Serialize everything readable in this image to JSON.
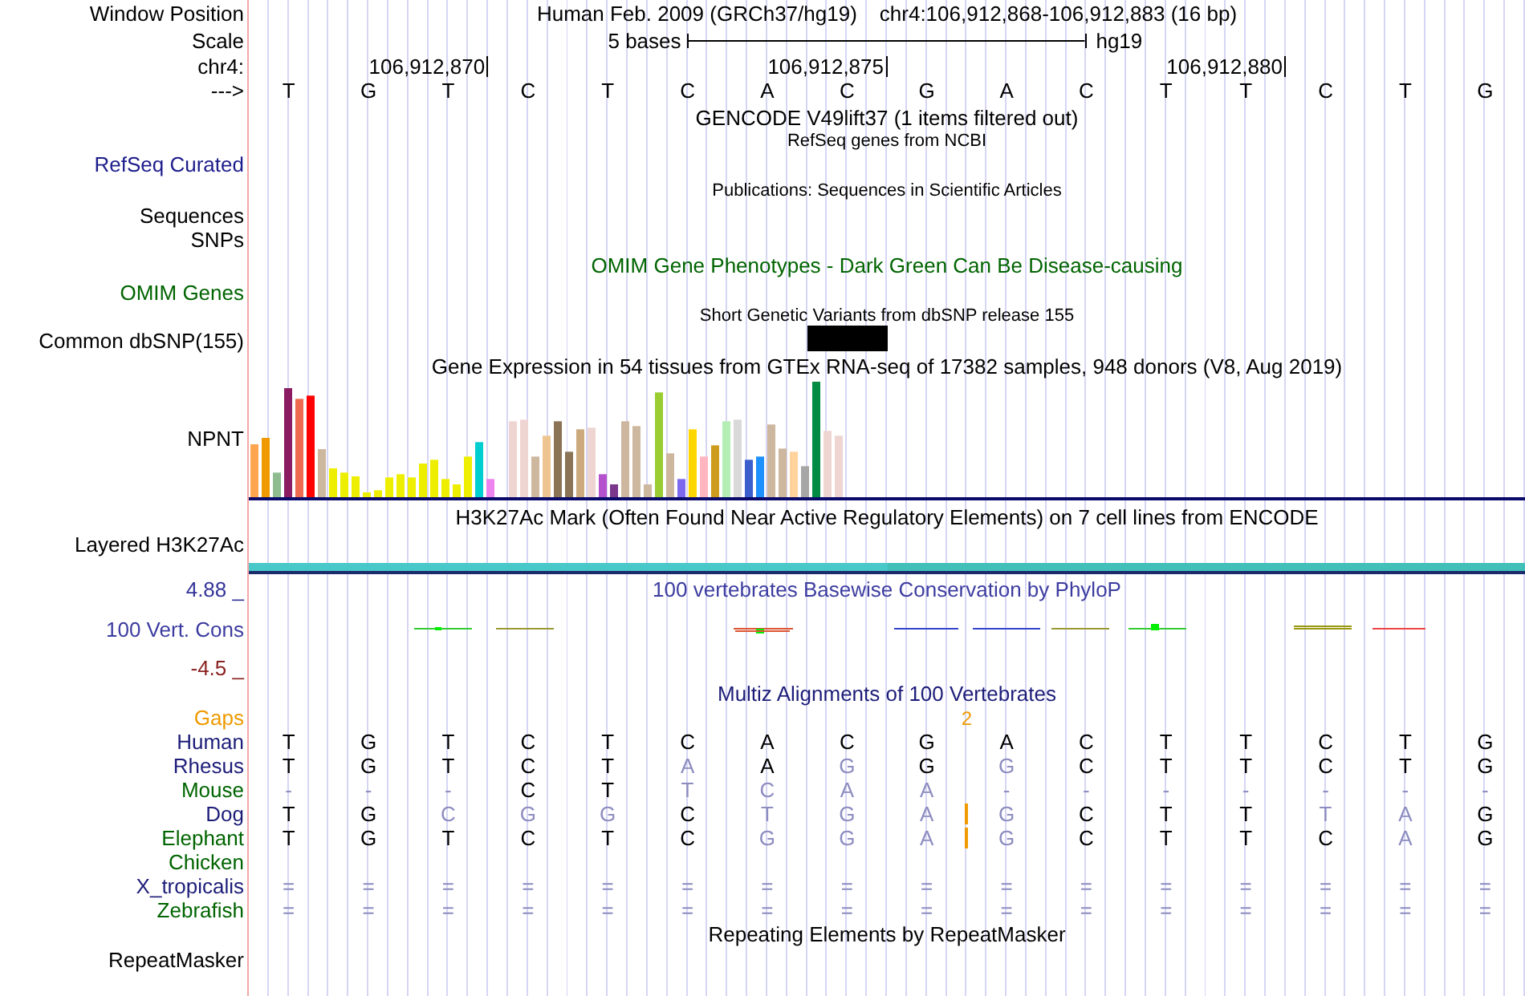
{
  "header": {
    "window_position_label": "Window Position",
    "assembly": "Human Feb. 2009 (GRCh37/hg19)",
    "region": "chr4:106,912,868-106,912,883 (16 bp)",
    "scale_label": "Scale",
    "scale_text": "5 bases",
    "scale_assembly": "hg19",
    "chrom_label": "chr4:",
    "ticks": [
      "106,912,870",
      "106,912,875",
      "106,912,880"
    ],
    "strand_label": "--->",
    "bases": [
      "T",
      "G",
      "T",
      "C",
      "T",
      "C",
      "A",
      "C",
      "G",
      "A",
      "C",
      "T",
      "T",
      "C",
      "T",
      "G"
    ]
  },
  "gencode": {
    "title": "GENCODE V49lift37 (1 items filtered out)"
  },
  "refseq": {
    "title": "RefSeq genes from NCBI",
    "label": "RefSeq Curated"
  },
  "publications": {
    "title": "Publications: Sequences in Scientific Articles",
    "labels": [
      "Sequences",
      "SNPs"
    ]
  },
  "omim": {
    "title": "OMIM Gene Phenotypes - Dark Green Can Be Disease-causing",
    "label": "OMIM Genes"
  },
  "dbsnp": {
    "title": "Short Genetic Variants from dbSNP release 155",
    "label": "Common dbSNP(155)"
  },
  "gtex": {
    "title": "Gene Expression in 54 tissues from GTEx RNA-seq of 17382 samples, 948 donors (V8, Aug 2019)",
    "label": "NPNT"
  },
  "h3k27ac": {
    "title": "H3K27Ac Mark (Often Found Near Active Regulatory Elements) on 7 cell lines from ENCODE",
    "label": "Layered H3K27Ac"
  },
  "phylop": {
    "title": "100 vertebrates Basewise Conservation by PhyloP",
    "label": "100 Vert. Cons",
    "max_label": "4.88 _",
    "min_label": "-4.5 _"
  },
  "multiz": {
    "title": "Multiz Alignments of 100 Vertebrates",
    "gaps_label": "Gaps",
    "species": [
      {
        "name": "Human",
        "color": "#1c1c78",
        "bases": [
          {
            "base": "T",
            "conserved": true
          },
          {
            "base": "G",
            "conserved": true
          },
          {
            "base": "T",
            "conserved": true
          },
          {
            "base": "C",
            "conserved": true
          },
          {
            "base": "T",
            "conserved": true
          },
          {
            "base": "C",
            "conserved": true
          },
          {
            "base": "A",
            "conserved": true
          },
          {
            "base": "C",
            "conserved": true
          },
          {
            "base": "G",
            "conserved": true,
            "gap_count": "2"
          },
          {
            "base": "A",
            "conserved": true
          },
          {
            "base": "C",
            "conserved": true
          },
          {
            "base": "T",
            "conserved": true
          },
          {
            "base": "T",
            "conserved": true
          },
          {
            "base": "C",
            "conserved": true
          },
          {
            "base": "T",
            "conserved": true
          },
          {
            "base": "G",
            "conserved": true
          }
        ]
      },
      {
        "name": "Rhesus",
        "color": "#1c1c78",
        "bases": [
          {
            "base": "T",
            "conserved": true
          },
          {
            "base": "G",
            "conserved": true
          },
          {
            "base": "T",
            "conserved": true
          },
          {
            "base": "C",
            "conserved": true
          },
          {
            "base": "T",
            "conserved": true
          },
          {
            "base": "A",
            "conserved": false
          },
          {
            "base": "A",
            "conserved": true
          },
          {
            "base": "G",
            "conserved": false
          },
          {
            "base": "G",
            "conserved": true
          },
          {
            "base": "G",
            "conserved": false
          },
          {
            "base": "C",
            "conserved": true
          },
          {
            "base": "T",
            "conserved": true
          },
          {
            "base": "T",
            "conserved": true
          },
          {
            "base": "C",
            "conserved": true
          },
          {
            "base": "T",
            "conserved": true
          },
          {
            "base": "G",
            "conserved": true
          }
        ]
      },
      {
        "name": "Mouse",
        "color": "#006400",
        "bases": [
          {
            "base": "-",
            "conserved": false
          },
          {
            "base": "-",
            "conserved": false
          },
          {
            "base": "-",
            "conserved": false
          },
          {
            "base": "C",
            "conserved": true
          },
          {
            "base": "T",
            "conserved": true
          },
          {
            "base": "T",
            "conserved": false
          },
          {
            "base": "C",
            "conserved": false
          },
          {
            "base": "A",
            "conserved": false
          },
          {
            "base": "A",
            "conserved": false
          },
          {
            "base": "-",
            "conserved": false
          },
          {
            "base": "-",
            "conserved": false
          },
          {
            "base": "-",
            "conserved": false
          },
          {
            "base": "-",
            "conserved": false
          },
          {
            "base": "-",
            "conserved": false
          },
          {
            "base": "-",
            "conserved": false
          },
          {
            "base": "-",
            "conserved": false
          }
        ]
      },
      {
        "name": "Dog",
        "color": "#1c1c78",
        "bases": [
          {
            "base": "T",
            "conserved": true
          },
          {
            "base": "G",
            "conserved": true
          },
          {
            "base": "C",
            "conserved": false
          },
          {
            "base": "G",
            "conserved": false
          },
          {
            "base": "G",
            "conserved": false
          },
          {
            "base": "C",
            "conserved": true
          },
          {
            "base": "T",
            "conserved": false
          },
          {
            "base": "G",
            "conserved": false
          },
          {
            "base": "A",
            "conserved": false,
            "insertion": true
          },
          {
            "base": "G",
            "conserved": false
          },
          {
            "base": "C",
            "conserved": true
          },
          {
            "base": "T",
            "conserved": true
          },
          {
            "base": "T",
            "conserved": true
          },
          {
            "base": "T",
            "conserved": false
          },
          {
            "base": "A",
            "conserved": false
          },
          {
            "base": "G",
            "conserved": true
          }
        ]
      },
      {
        "name": "Elephant",
        "color": "#006400",
        "bases": [
          {
            "base": "T",
            "conserved": true
          },
          {
            "base": "G",
            "conserved": true
          },
          {
            "base": "T",
            "conserved": true
          },
          {
            "base": "C",
            "conserved": true
          },
          {
            "base": "T",
            "conserved": true
          },
          {
            "base": "C",
            "conserved": true
          },
          {
            "base": "G",
            "conserved": false
          },
          {
            "base": "G",
            "conserved": false
          },
          {
            "base": "A",
            "conserved": false,
            "insertion": true
          },
          {
            "base": "G",
            "conserved": false
          },
          {
            "base": "C",
            "conserved": true
          },
          {
            "base": "T",
            "conserved": true
          },
          {
            "base": "T",
            "conserved": true
          },
          {
            "base": "C",
            "conserved": true
          },
          {
            "base": "A",
            "conserved": false
          },
          {
            "base": "G",
            "conserved": true
          }
        ]
      },
      {
        "name": "Chicken",
        "color": "#006400"
      },
      {
        "name": "X_tropicalis",
        "color": "#1c1c78",
        "bases": [
          {
            "base": "=",
            "conserved": false
          },
          {
            "base": "=",
            "conserved": false
          },
          {
            "base": "=",
            "conserved": false
          },
          {
            "base": "=",
            "conserved": false
          },
          {
            "base": "=",
            "conserved": false
          },
          {
            "base": "=",
            "conserved": false
          },
          {
            "base": "=",
            "conserved": false
          },
          {
            "base": "=",
            "conserved": false
          },
          {
            "base": "=",
            "conserved": false
          },
          {
            "base": "=",
            "conserved": false
          },
          {
            "base": "=",
            "conserved": false
          },
          {
            "base": "=",
            "conserved": false
          },
          {
            "base": "=",
            "conserved": false
          },
          {
            "base": "=",
            "conserved": false
          },
          {
            "base": "=",
            "conserved": false
          },
          {
            "base": "=",
            "conserved": false
          }
        ]
      },
      {
        "name": "Zebrafish",
        "color": "#006400",
        "bases": [
          {
            "base": "=",
            "conserved": false
          },
          {
            "base": "=",
            "conserved": false
          },
          {
            "base": "=",
            "conserved": false
          },
          {
            "base": "=",
            "conserved": false
          },
          {
            "base": "=",
            "conserved": false
          },
          {
            "base": "=",
            "conserved": false
          },
          {
            "base": "=",
            "conserved": false
          },
          {
            "base": "=",
            "conserved": false
          },
          {
            "base": "=",
            "conserved": false
          },
          {
            "base": "=",
            "conserved": false
          },
          {
            "base": "=",
            "conserved": false
          },
          {
            "base": "=",
            "conserved": false
          },
          {
            "base": "=",
            "conserved": false
          },
          {
            "base": "=",
            "conserved": false
          },
          {
            "base": "=",
            "conserved": false
          },
          {
            "base": "=",
            "conserved": false
          }
        ]
      }
    ]
  },
  "repeatmasker": {
    "title": "Repeating Elements by RepeatMasker",
    "label": "RepeatMasker"
  }
}
